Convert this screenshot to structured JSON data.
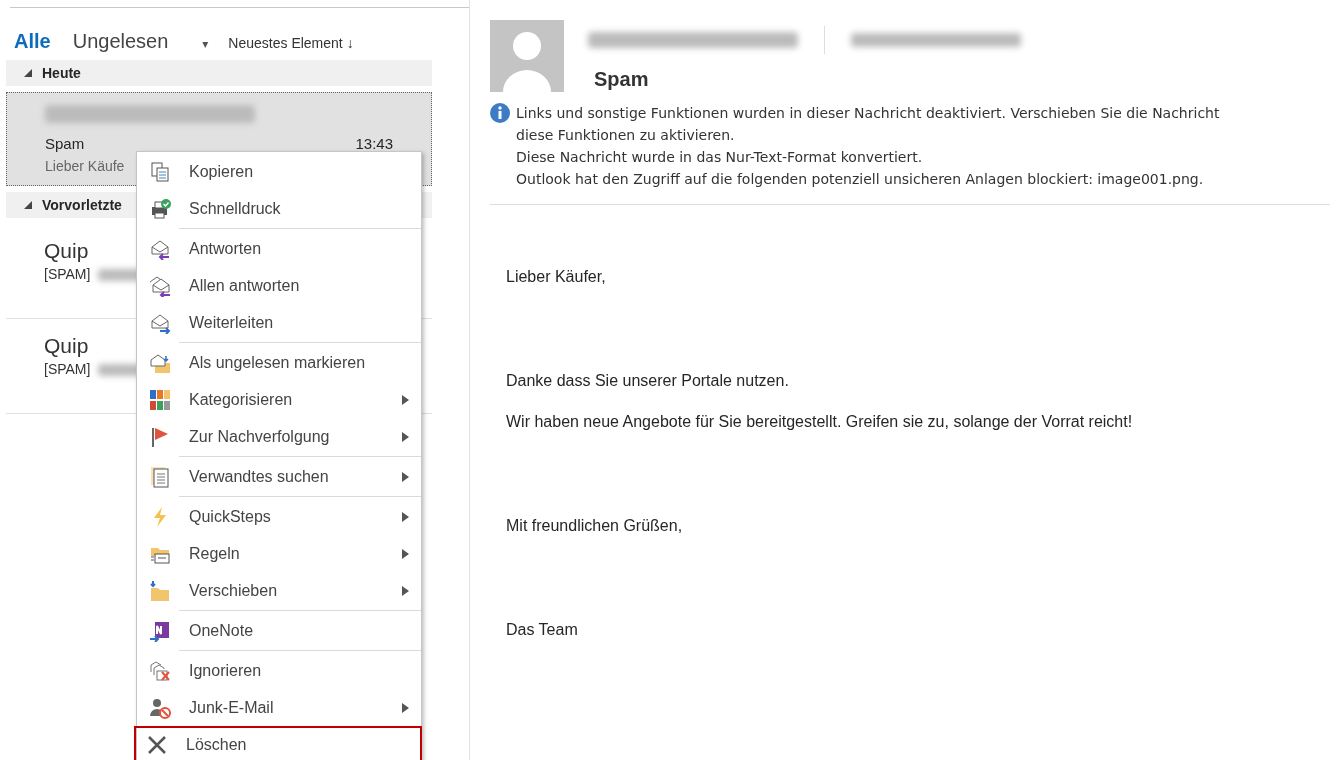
{
  "filters": {
    "items": [
      {
        "label": "Alle",
        "selected": true
      },
      {
        "label": "Ungelesen",
        "selected": false
      }
    ],
    "dropdown": "▾",
    "sort": {
      "label": "Neuestes Element",
      "arrow": "↓"
    }
  },
  "mail_list": [
    {
      "kind": "group",
      "label": "Heute",
      "expanded": true
    },
    {
      "kind": "mail",
      "sender_redacted": true,
      "subject": "Spam",
      "time": "13:43",
      "preview": "Lieber Käufe",
      "selected": true
    },
    {
      "kind": "group",
      "label": "Vorvorletzte",
      "expanded": true
    },
    {
      "kind": "mail",
      "sender": "Quip",
      "preview": "[SPAM]",
      "preview_redacted": true,
      "selected": false
    },
    {
      "kind": "mail",
      "sender": "Quip",
      "preview": "[SPAM]",
      "preview_redacted": true,
      "selected": false
    }
  ],
  "context_menu": [
    {
      "label": "Kopieren",
      "submenu": false,
      "separator_before": false,
      "highlighted": false
    },
    {
      "label": "Schnelldruck",
      "submenu": false,
      "separator_before": false,
      "highlighted": false
    },
    {
      "label": "Antworten",
      "submenu": false,
      "separator_before": true,
      "highlighted": false
    },
    {
      "label": "Allen antworten",
      "submenu": false,
      "separator_before": false,
      "highlighted": false
    },
    {
      "label": "Weiterleiten",
      "submenu": false,
      "separator_before": false,
      "highlighted": false
    },
    {
      "label": "Als ungelesen markieren",
      "submenu": false,
      "separator_before": true,
      "highlighted": false
    },
    {
      "label": "Kategorisieren",
      "submenu": true,
      "separator_before": false,
      "highlighted": false
    },
    {
      "label": "Zur Nachverfolgung",
      "submenu": true,
      "separator_before": false,
      "highlighted": false
    },
    {
      "label": "Verwandtes suchen",
      "submenu": true,
      "separator_before": true,
      "highlighted": false
    },
    {
      "label": "QuickSteps",
      "submenu": true,
      "separator_before": true,
      "highlighted": false
    },
    {
      "label": "Regeln",
      "submenu": true,
      "separator_before": false,
      "highlighted": false
    },
    {
      "label": "Verschieben",
      "submenu": true,
      "separator_before": false,
      "highlighted": false
    },
    {
      "label": "OneNote",
      "submenu": false,
      "separator_before": true,
      "highlighted": false
    },
    {
      "label": "Ignorieren",
      "submenu": false,
      "separator_before": true,
      "highlighted": false
    },
    {
      "label": "Junk-E-Mail",
      "submenu": true,
      "separator_before": false,
      "highlighted": false
    },
    {
      "label": "Löschen",
      "submenu": false,
      "separator_before": false,
      "highlighted": true
    }
  ],
  "reading_pane": {
    "sender_redacted": true,
    "recipient_redacted": true,
    "subject": "Spam",
    "info_lines": [
      "Links und sonstige Funktionen wurden in dieser Nachricht deaktiviert. Verschieben Sie die Nachricht",
      "diese Funktionen zu aktivieren.",
      "Diese Nachricht wurde in das Nur-Text-Format konvertiert.",
      "Outlook hat den Zugriff auf die folgenden potenziell unsicheren Anlagen blockiert: image001.png."
    ],
    "body": [
      "Lieber Käufer,",
      "Danke dass Sie unserer Portale nutzen.",
      "Wir haben neue Angebote für Sie bereitgestellt. Greifen sie zu, solange der Vorrat reicht!",
      "Mit freundlichen Grüßen,",
      "Das Team"
    ]
  }
}
